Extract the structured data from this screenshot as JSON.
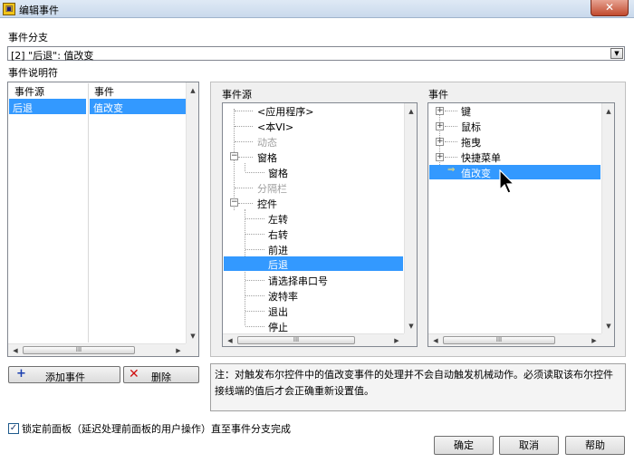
{
  "window": {
    "title": "编辑事件",
    "icon_text": "▣"
  },
  "labels": {
    "branch": "事件分支",
    "descriptor": "事件说明符",
    "event_source": "事件源",
    "event": "事件"
  },
  "branch_select": {
    "value": "[2] \"后退\": 值改变",
    "arrow": "▼"
  },
  "descriptor_list": {
    "headers": [
      "事件源",
      "事件"
    ],
    "rows": [
      [
        "后退",
        "值改变"
      ]
    ]
  },
  "source_tree": [
    {
      "label": "<应用程序>",
      "gray": false
    },
    {
      "label": "<本VI>",
      "gray": false
    },
    {
      "label": "动态",
      "gray": true
    },
    {
      "label": "窗格",
      "gray": false
    },
    {
      "label": "窗格",
      "gray": false
    },
    {
      "label": "分隔栏",
      "gray": true
    },
    {
      "label": "控件",
      "gray": false
    },
    {
      "label": "左转",
      "gray": false
    },
    {
      "label": "右转",
      "gray": false
    },
    {
      "label": "前进",
      "gray": false
    },
    {
      "label": "后退",
      "gray": false
    },
    {
      "label": "请选择串口号",
      "gray": false
    },
    {
      "label": "波特率",
      "gray": false
    },
    {
      "label": "退出",
      "gray": false
    },
    {
      "label": "停止",
      "gray": false
    }
  ],
  "event_tree": [
    {
      "label": "键"
    },
    {
      "label": "鼠标"
    },
    {
      "label": "拖曳"
    },
    {
      "label": "快捷菜单"
    },
    {
      "label": "值改变"
    }
  ],
  "buttons": {
    "add_event": "添加事件",
    "add_icon": "+",
    "delete": "删除",
    "delete_icon": "✕",
    "ok": "确定",
    "cancel": "取消",
    "help": "帮助"
  },
  "note": "注：对触发布尔控件中的值改变事件的处理并不会自动触发机械动作。必须读取该布尔控件接线端的值后才会正确重新设置值。",
  "lock_panel": {
    "label": "锁定前面板（延迟处理前面板的用户操作）直至事件分支完成",
    "checked": true,
    "mark": "✓"
  },
  "scroll_glyphs": {
    "up": "▲",
    "down": "▼",
    "left": "◀",
    "right": "▶",
    "grip": "III"
  },
  "icons": {
    "close": "✕",
    "expand": "+",
    "collapse": "−",
    "leaf_arrow": "⇒"
  }
}
